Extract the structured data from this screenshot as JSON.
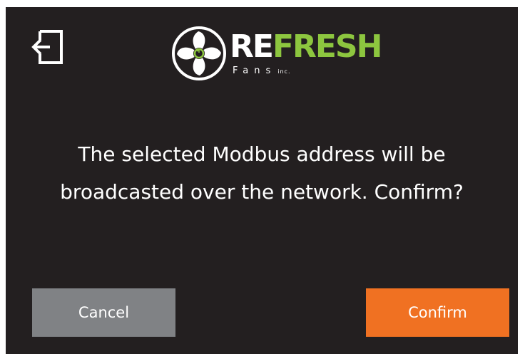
{
  "header": {
    "exit_icon": "exit-icon",
    "logo": {
      "mark_icon": "fan-icon",
      "word_part1": "RE",
      "word_part2": "FRESH",
      "subtitle": "Fans",
      "inc": "inc.",
      "colors": {
        "accent": "#8dc63f",
        "text": "#ffffff"
      }
    }
  },
  "dialog": {
    "message": "The selected Modbus address will be broadcasted over the network. Confirm?"
  },
  "buttons": {
    "cancel_label": "Cancel",
    "confirm_label": "Confirm"
  },
  "colors": {
    "background": "#231f20",
    "cancel": "#808285",
    "confirm": "#f07122"
  }
}
